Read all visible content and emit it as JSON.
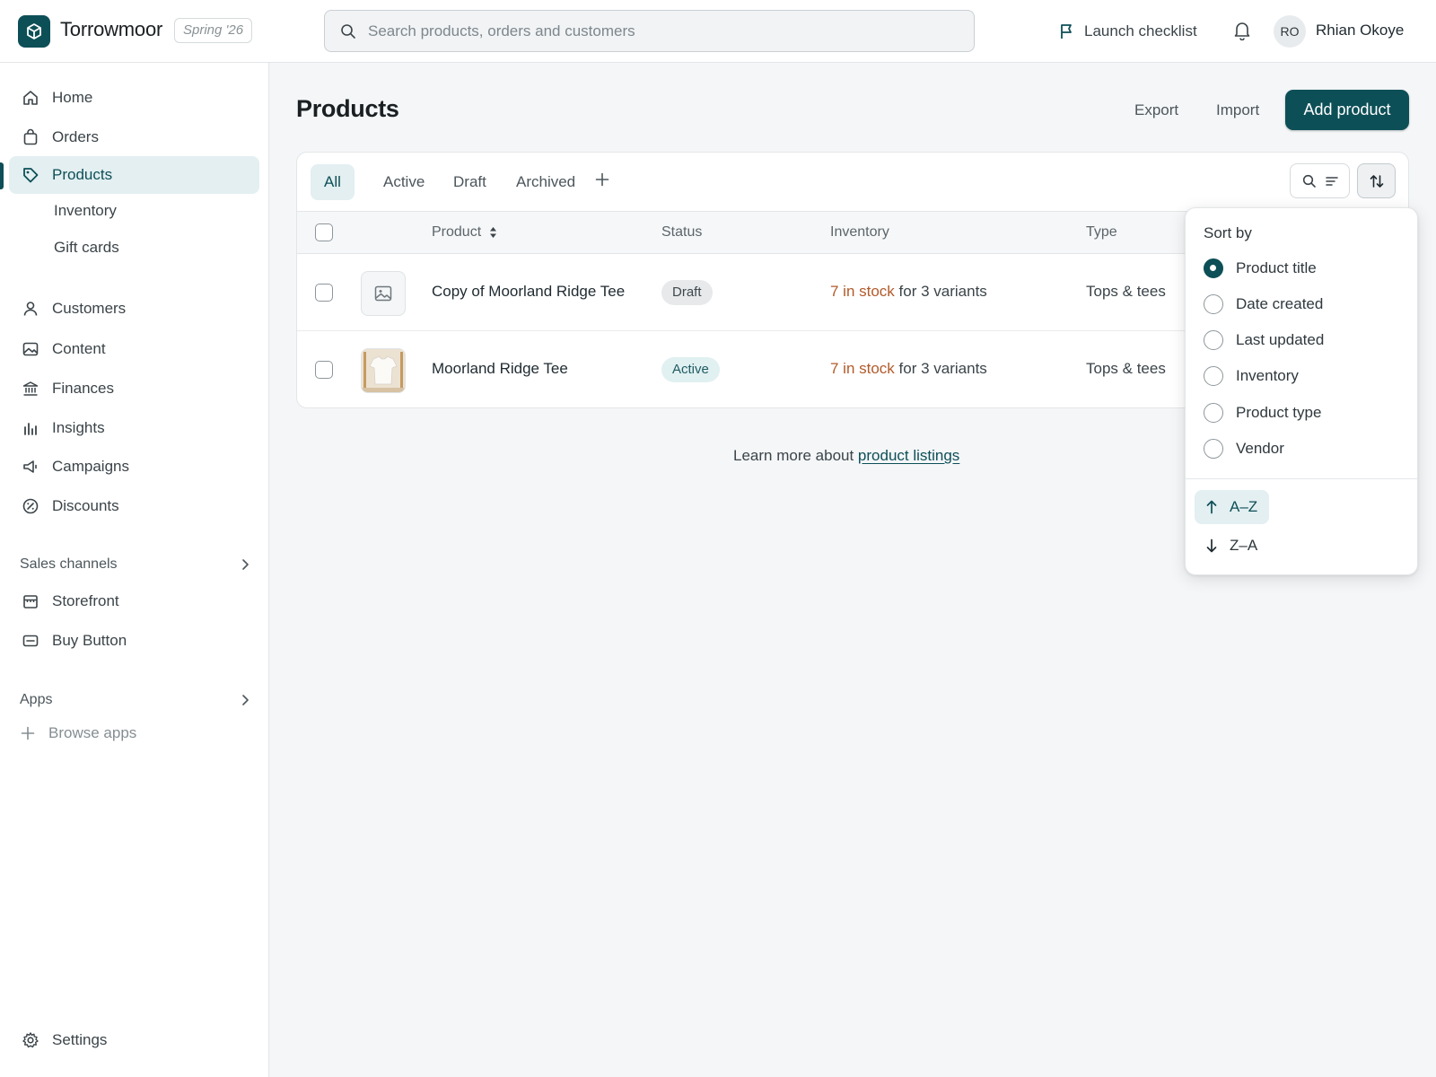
{
  "topbar": {
    "brand": "Torrowmoor",
    "season": "Spring '26",
    "search_placeholder": "Search products, orders and customers",
    "launch_checklist": "Launch checklist",
    "user_initials": "RO",
    "user_name": "Rhian Okoye"
  },
  "sidebar": {
    "items": [
      {
        "label": "Home",
        "icon": "home-icon"
      },
      {
        "label": "Orders",
        "icon": "bag-icon"
      },
      {
        "label": "Products",
        "icon": "tag-icon"
      },
      {
        "label": "Customers",
        "icon": "person-icon"
      },
      {
        "label": "Content",
        "icon": "image-icon"
      },
      {
        "label": "Finances",
        "icon": "bank-icon"
      },
      {
        "label": "Insights",
        "icon": "bar-chart-icon"
      },
      {
        "label": "Campaigns",
        "icon": "megaphone-icon"
      },
      {
        "label": "Discounts",
        "icon": "discount-icon"
      }
    ],
    "sub_items": [
      "Inventory",
      "Gift cards"
    ],
    "sales_channels": {
      "heading": "Sales channels",
      "items": [
        {
          "label": "Storefront",
          "icon": "store-icon"
        },
        {
          "label": "Buy Button",
          "icon": "buy-button-icon"
        }
      ]
    },
    "apps": {
      "heading": "Apps",
      "browse": "Browse apps"
    },
    "settings": "Settings"
  },
  "main": {
    "title": "Products",
    "export_label": "Export",
    "import_label": "Import",
    "add_label": "Add product",
    "tabs": [
      "All",
      "Active",
      "Draft",
      "Archived"
    ],
    "selected_tab": "All",
    "columns": {
      "product": "Product",
      "status": "Status",
      "inventory": "Inventory",
      "type": "Type"
    },
    "rows": [
      {
        "title": "Copy of Moorland Ridge Tee",
        "status": "Draft",
        "stock": "7 in stock",
        "variants": " for 3 variants",
        "type": "Tops & tees",
        "thumbnail": "placeholder-image-icon"
      },
      {
        "title": "Moorland Ridge Tee",
        "status": "Active",
        "stock": "7 in stock",
        "variants": " for 3 variants",
        "type": "Tops & tees",
        "thumbnail": "tee-photo"
      }
    ],
    "learn_more_prefix": "Learn more about ",
    "learn_more_link": "product listings"
  },
  "sort_menu": {
    "title": "Sort by",
    "options": [
      "Product title",
      "Date created",
      "Last updated",
      "Inventory",
      "Product type",
      "Vendor"
    ],
    "selected": "Product title",
    "directions": [
      "A–Z",
      "Z–A"
    ],
    "selected_direction": "A–Z"
  },
  "colors": {
    "brand": "#0d4f57",
    "stock_warning": "#b25a2a",
    "active_bg": "#e3eff1"
  }
}
